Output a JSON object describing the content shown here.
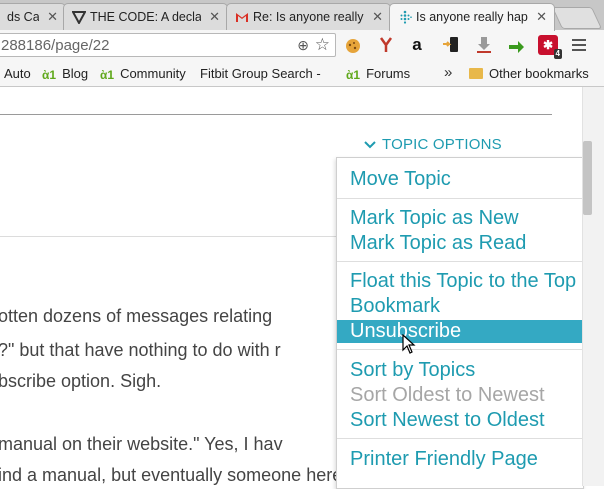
{
  "browser": {
    "tabs": [
      {
        "title": "ds Can",
        "icon": "page-icon"
      },
      {
        "title": "THE CODE: A declas",
        "icon": "v-logo-icon"
      },
      {
        "title": "Re: Is anyone really",
        "icon": "gmail-icon"
      },
      {
        "title": "Is anyone really hap",
        "icon": "fitbit-icon"
      }
    ],
    "address": {
      "url": "288186/page/22"
    },
    "bookmarks": [
      {
        "label": "Auto",
        "icon": "none"
      },
      {
        "label": "Blog",
        "icon": "fitbit-leaf-icon"
      },
      {
        "label": "Community",
        "icon": "fitbit-leaf-icon"
      },
      {
        "label": "Fitbit Group Search -",
        "icon": "page-icon"
      },
      {
        "label": "Forums",
        "icon": "fitbit-leaf-icon"
      },
      {
        "label": "Other bookmarks",
        "icon": "folder-icon"
      }
    ],
    "more_bookmarks": "»",
    "lastpass_badge": "4"
  },
  "page": {
    "topic_options_label": "TOPIC OPTIONS",
    "post_lines": [
      "otten dozens of messages relating",
      "?\" but that have nothing to do with r",
      "bscribe option. Sigh.",
      "manual on their website.\" Yes, I hav",
      "ind a manual, but eventually someone here sent me"
    ]
  },
  "menu": {
    "groups": [
      [
        "Move Topic"
      ],
      [
        "Mark Topic as New",
        "Mark Topic as Read"
      ],
      [
        "Float this Topic to the Top",
        "Bookmark",
        "Unsubscribe"
      ],
      [
        "Sort by Topics",
        "Sort Oldest to Newest",
        "Sort Newest to Oldest"
      ],
      [
        "Printer Friendly Page"
      ]
    ],
    "highlighted": "Unsubscribe",
    "disabled": "Sort Oldest to Newest"
  },
  "colors": {
    "accent": "#1e9bb0",
    "highlight": "#34a9c3",
    "disabled": "#a6a6a6"
  }
}
